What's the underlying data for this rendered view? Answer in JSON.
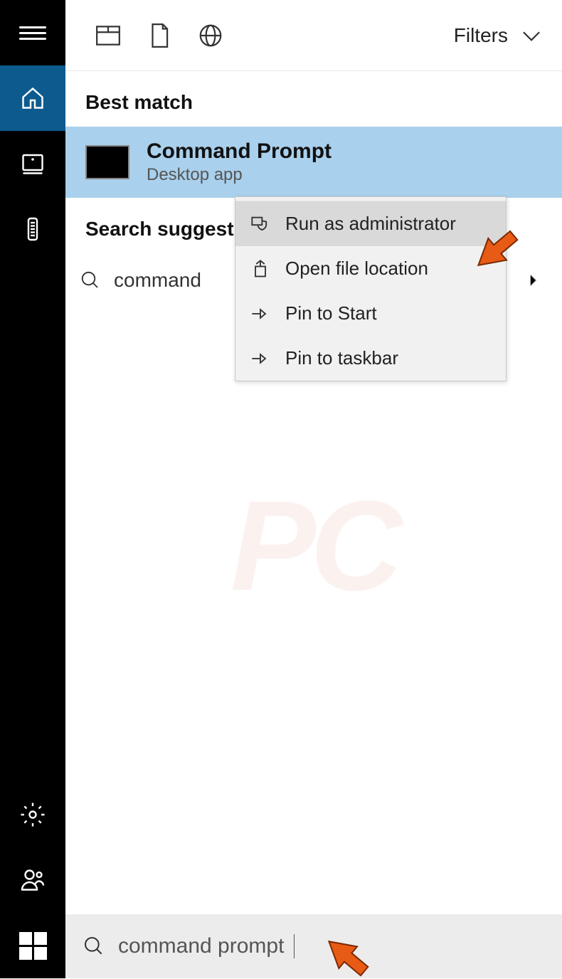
{
  "sidebar": {
    "items": [
      "menu",
      "home",
      "apps",
      "remote"
    ],
    "bottom": [
      "settings",
      "profile",
      "start"
    ]
  },
  "toolbar": {
    "filters_label": "Filters"
  },
  "sections": {
    "best_match_label": "Best match",
    "suggest_label": "Search suggestio"
  },
  "best_match": {
    "title": "Command Prompt",
    "subtitle": "Desktop app"
  },
  "suggestion": {
    "text": "command "
  },
  "context_menu": {
    "items": [
      {
        "icon": "admin-shield-icon",
        "label": "Run as administrator",
        "hover": true
      },
      {
        "icon": "folder-open-icon",
        "label": "Open file location",
        "hover": false
      },
      {
        "icon": "pin-icon",
        "label": "Pin to Start",
        "hover": false
      },
      {
        "icon": "pin-icon",
        "label": "Pin to taskbar",
        "hover": false
      }
    ]
  },
  "search": {
    "query": "command prompt"
  },
  "colors": {
    "sidebar_bg": "#000000",
    "active_blue": "#0d5b8e",
    "selection_blue": "#a9d0ec",
    "arrow_orange": "#e85b14"
  }
}
